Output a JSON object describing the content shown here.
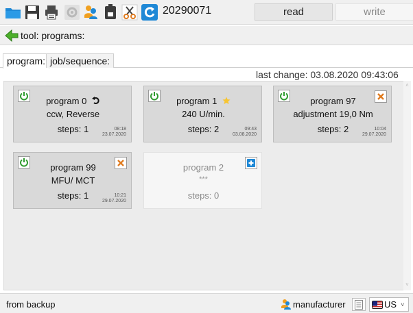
{
  "toolbar": {
    "identifier": "20290071",
    "read_label": "read",
    "write_label": "write",
    "icons": [
      "folder-icon",
      "save-icon",
      "print-icon",
      "settings-icon",
      "users-icon",
      "tool-icon",
      "cut-icon",
      "refresh-icon"
    ]
  },
  "path": {
    "text": "tool: programs:"
  },
  "tabs": [
    {
      "label": "program:",
      "active": true
    },
    {
      "label": "job/sequence:",
      "active": false
    }
  ],
  "last_change": "last change: 03.08.2020  09:43:06",
  "programs": [
    {
      "title": "program 0",
      "title_icon": "reverse-rotation-icon",
      "desc": "ccw, Reverse",
      "steps": "steps: 1",
      "time": "08:18",
      "date": "23.07.2020",
      "corner": ""
    },
    {
      "title": "program 1",
      "title_icon": "star-icon",
      "desc": "240 U/min.",
      "steps": "steps: 2",
      "time": "09:43",
      "date": "03.08.2020",
      "corner": ""
    },
    {
      "title": "program 97",
      "title_icon": "",
      "desc": "adjustment 19,0 Nm",
      "steps": "steps: 2",
      "time": "10:04",
      "date": "29.07.2020",
      "corner": "delete"
    },
    {
      "title": "program 99",
      "title_icon": "",
      "desc": "MFU/ MCT",
      "steps": "steps: 1",
      "time": "10:21",
      "date": "29.07.2020",
      "corner": "delete"
    },
    {
      "title": "program 2",
      "title_icon": "",
      "desc": "***",
      "steps": "steps: 0",
      "time": "",
      "date": "",
      "corner": "add"
    }
  ],
  "status": {
    "source": "from backup",
    "user_role": "manufacturer",
    "language": "US"
  },
  "colors": {
    "accent_blue": "#1e88d6",
    "power_green": "#2e9b2e",
    "delete_orange": "#e07b1f",
    "back_green": "#4caf2a"
  }
}
